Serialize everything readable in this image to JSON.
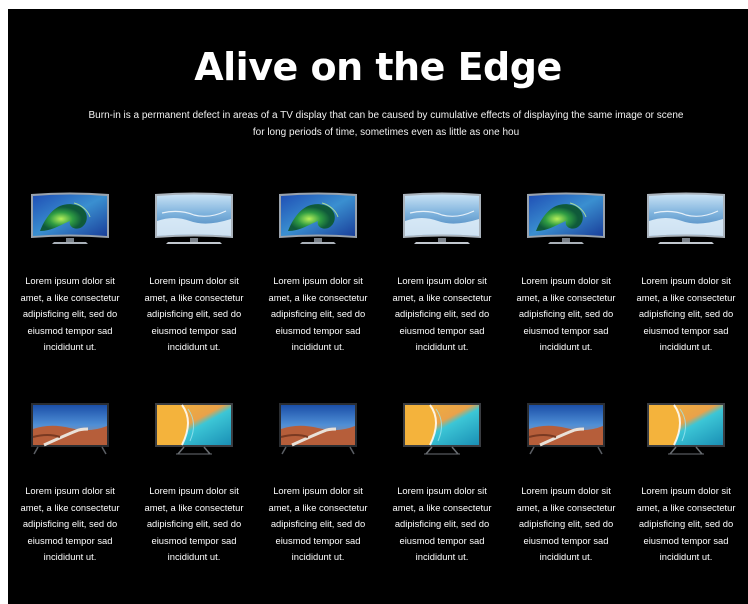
{
  "header": {
    "title": "Alive on the Edge",
    "description": "Burn-in is a permanent defect in areas of a TV display that can be caused by cumulative effects of displaying the same image or scene for long periods of time, sometimes even as little as one hou"
  },
  "rows": [
    {
      "items": [
        {
          "image": "curved-tv-green-wave",
          "caption": "Lorem ipsum dolor sit\namet, a like consectetur\nadipisficing elit, sed do\neiusmod tempor sad\nincididunt ut."
        },
        {
          "image": "curved-tv-ice-scene",
          "caption": "Lorem ipsum dolor sit\namet, a like consectetur\nadipisficing elit, sed do\neiusmod tempor sad\nincididunt ut."
        },
        {
          "image": "curved-tv-green-wave",
          "caption": "Lorem ipsum dolor sit\namet, a like consectetur\nadipisficing elit, sed do\neiusmod tempor sad\nincididunt ut."
        },
        {
          "image": "curved-tv-ice-scene",
          "caption": "Lorem ipsum dolor sit\namet, a like consectetur\nadipisficing elit, sed do\neiusmod tempor sad\nincididunt ut."
        },
        {
          "image": "curved-tv-green-wave",
          "caption": "Lorem ipsum dolor sit\namet, a like consectetur\nadipisficing elit, sed do\neiusmod tempor sad\nincididunt ut."
        },
        {
          "image": "curved-tv-ice-scene",
          "caption": "Lorem ipsum dolor sit\namet, a like consectetur\nadipisficing elit, sed do\neiusmod tempor sad\nincididunt ut."
        }
      ]
    },
    {
      "items": [
        {
          "image": "flat-tv-canyon-road",
          "caption": "Lorem ipsum dolor sit\namet, a like consectetur\nadipisficing elit, sed do\neiusmod tempor sad\nincididunt ut."
        },
        {
          "image": "flat-tv-beach-aerial",
          "caption": "Lorem ipsum dolor sit\namet, a like consectetur\nadipisficing elit, sed do\neiusmod tempor sad\nincididunt ut."
        },
        {
          "image": "flat-tv-canyon-road",
          "caption": "Lorem ipsum dolor sit\namet, a like consectetur\nadipisficing elit, sed do\neiusmod tempor sad\nincididunt ut."
        },
        {
          "image": "flat-tv-beach-aerial",
          "caption": "Lorem ipsum dolor sit\namet, a like consectetur\nadipisficing elit, sed do\neiusmod tempor sad\nincididunt ut."
        },
        {
          "image": "flat-tv-canyon-road",
          "caption": "Lorem ipsum dolor sit\namet, a like consectetur\nadipisficing elit, sed do\neiusmod tempor sad\nincididunt ut."
        },
        {
          "image": "flat-tv-beach-aerial",
          "caption": "Lorem ipsum dolor sit\namet, a like consectetur\nadipisficing elit, sed do\neiusmod tempor sad\nincididunt ut."
        }
      ]
    }
  ],
  "colors": {
    "background": "#000000",
    "text": "#ffffff"
  }
}
